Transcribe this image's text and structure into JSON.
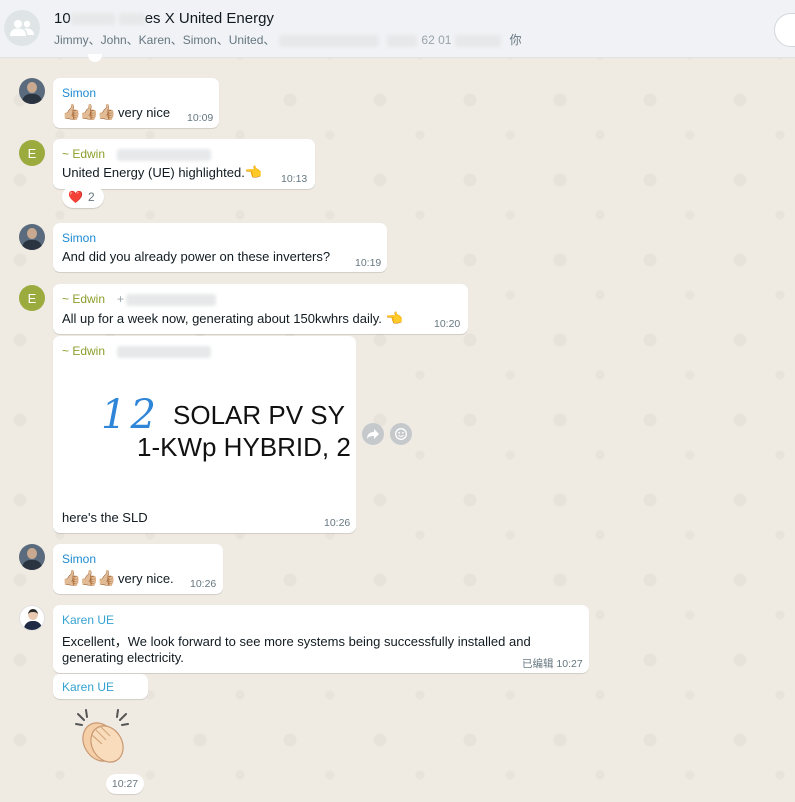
{
  "header": {
    "title_start": "10",
    "title_end": "es X United Energy",
    "members_visible": "Jimmy、John、Karen、Simon、United、",
    "members_mid": "62 01",
    "members_end": "你"
  },
  "messages": [
    {
      "sender": "Simon",
      "thumbs": "👍🏼👍🏼👍🏼",
      "text": "very nice",
      "time": "10:09"
    },
    {
      "sender": "~ Edwin",
      "text": "United Energy (UE) highlighted.",
      "emoji": "👈",
      "time": "10:13",
      "reaction": {
        "emoji": "❤️",
        "count": "2"
      }
    },
    {
      "sender": "Simon",
      "text": "And did you already power on these inverters?",
      "time": "10:19"
    },
    {
      "sender": "~ Edwin",
      "sender_extra": "+",
      "text": "All up for a week now, generating about 150kwhrs daily.",
      "emoji": "👈",
      "time": "10:20"
    },
    {
      "sender": "~ Edwin",
      "image": {
        "handwritten": "12",
        "line1": "SOLAR PV SY",
        "line2": "1-KWp HYBRID, 2"
      },
      "caption": "here's the SLD",
      "time": "10:26"
    },
    {
      "sender": "Simon",
      "thumbs": "👍🏼👍🏼👍🏼",
      "text": "very nice.",
      "time": "10:26"
    },
    {
      "sender": "Karen UE",
      "text_line1": "Excellent，We look forward to see more systems being successfully installed and",
      "text_line2": "generating electricity.",
      "edited_label": "已编辑",
      "time": "10:27"
    },
    {
      "sender": "Karen UE",
      "sticker": "clapping-hands",
      "time": "10:27"
    }
  ],
  "colors": {
    "simon": "#1f8ad2",
    "edwin": "#8c9f2b",
    "karen": "#35a2d1",
    "avatar_e": "#9bab3e"
  },
  "icons": {
    "forward": "forward-icon",
    "emoji": "emoji-icon",
    "group": "group-icon"
  }
}
